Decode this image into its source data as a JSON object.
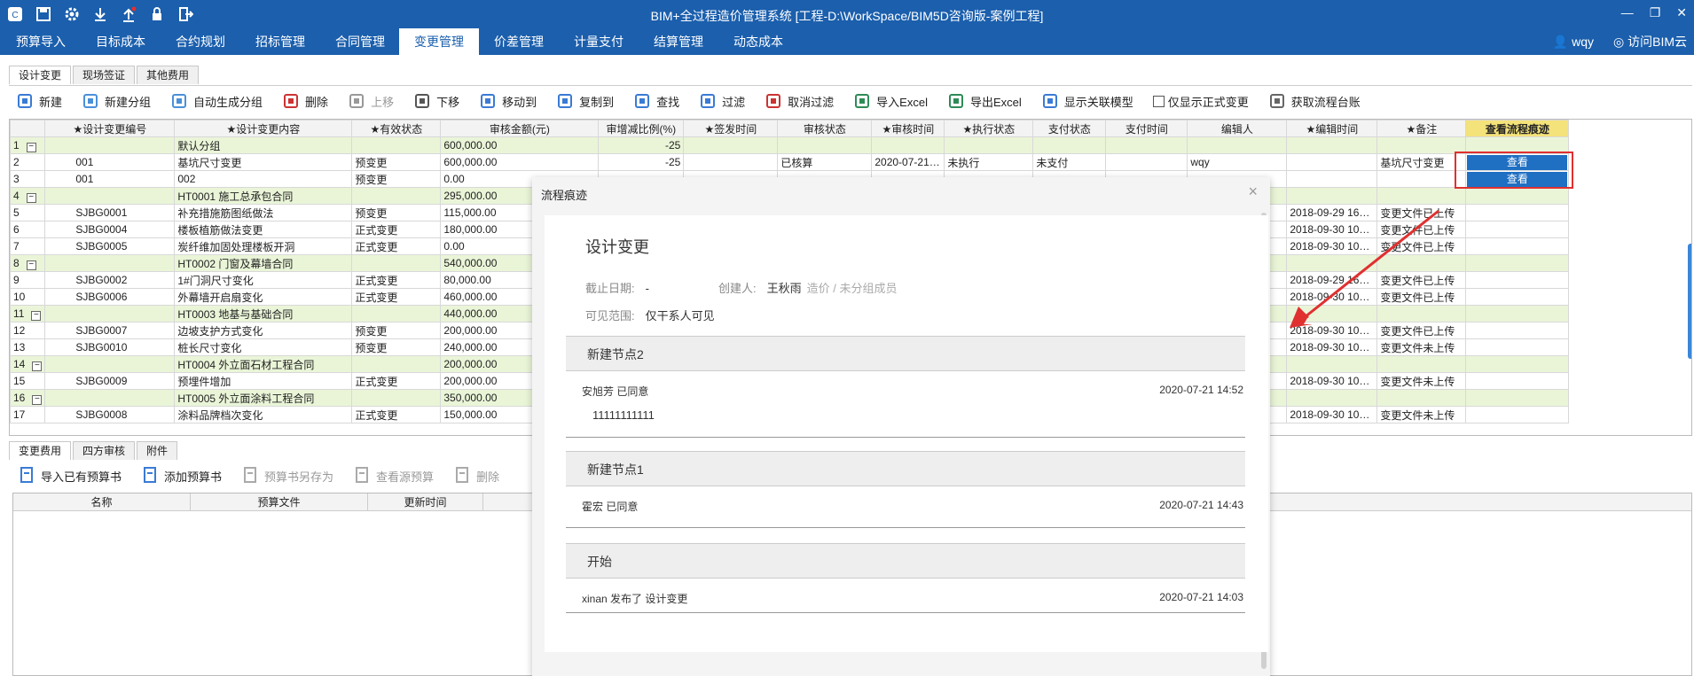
{
  "window": {
    "title": "BIM+全过程造价管理系统 [工程-D:\\WorkSpace/BIM5D咨询版-案例工程]"
  },
  "menu": [
    "预算导入",
    "目标成本",
    "合约规划",
    "招标管理",
    "合同管理",
    "变更管理",
    "价差管理",
    "计量支付",
    "结算管理",
    "动态成本"
  ],
  "user": {
    "name": "wqy",
    "visit": "访问BIM云"
  },
  "tabs": [
    "设计变更",
    "现场签证",
    "其他费用"
  ],
  "toolbar": [
    {
      "label": "新建",
      "icon": "new-file-icon",
      "disabled": false
    },
    {
      "label": "新建分组",
      "icon": "folder-icon",
      "disabled": false
    },
    {
      "label": "自动生成分组",
      "icon": "folder-icon",
      "disabled": false
    },
    {
      "label": "删除",
      "icon": "delete-icon",
      "disabled": false
    },
    {
      "label": "上移",
      "icon": "move-up-icon",
      "disabled": true
    },
    {
      "label": "下移",
      "icon": "move-down-icon",
      "disabled": false
    },
    {
      "label": "移动到",
      "icon": "move-to-icon",
      "disabled": false
    },
    {
      "label": "复制到",
      "icon": "copy-icon",
      "disabled": false
    },
    {
      "label": "查找",
      "icon": "search-icon",
      "disabled": false
    },
    {
      "label": "过滤",
      "icon": "filter-icon",
      "disabled": false
    },
    {
      "label": "取消过滤",
      "icon": "cancel-filter-icon",
      "disabled": false
    },
    {
      "label": "导入Excel",
      "icon": "excel-import-icon",
      "disabled": false
    },
    {
      "label": "导出Excel",
      "icon": "excel-export-icon",
      "disabled": false
    },
    {
      "label": "显示关联模型",
      "icon": "model-icon",
      "disabled": false
    },
    {
      "label": "仅显示正式变更",
      "icon": "checkbox",
      "disabled": false
    },
    {
      "label": "获取流程台账",
      "icon": "ledger-icon",
      "disabled": false
    }
  ],
  "grid": {
    "columns": [
      "",
      "★设计变更编号",
      "★设计变更内容",
      "★有效状态",
      "审核金额(元)",
      "审增减比例(%)",
      "★签发时间",
      "审核状态",
      "★审核时间",
      "★执行状态",
      "支付状态",
      "支付时间",
      "编辑人",
      "★编辑时间",
      "★备注",
      "查看流程痕迹"
    ],
    "view_label": "查看",
    "rows": [
      {
        "n": "1",
        "group": true,
        "code": "",
        "content": "默认分组",
        "state": "",
        "amount": "600,000.00",
        "ratio": "-25",
        "c6": "",
        "c7": "",
        "c8": "",
        "c9": "",
        "c10": "",
        "c11": "",
        "c12": "",
        "c13": "",
        "c14": "",
        "view": false
      },
      {
        "n": "2",
        "group": false,
        "code": "001",
        "content": "基坑尺寸变更",
        "state": "预变更",
        "amount": "600,000.00",
        "ratio": "-25",
        "c6": "",
        "c7": "已核算",
        "c8": "2020-07-21…",
        "c9": "未执行",
        "c10": "未支付",
        "c11": "",
        "c12": "wqy",
        "c13": "",
        "c14": "基坑尺寸变更",
        "view": true
      },
      {
        "n": "3",
        "group": false,
        "code": "001",
        "content": "002",
        "state": "预变更",
        "amount": "0.00",
        "ratio": "",
        "c6": "",
        "c7": "",
        "c8": "",
        "c9": "",
        "c10": "",
        "c11": "",
        "c12": "",
        "c13": "",
        "c14": "",
        "view": true
      },
      {
        "n": "4",
        "group": true,
        "code": "",
        "content": "HT0001 施工总承包合同",
        "state": "",
        "amount": "295,000.00",
        "ratio": "",
        "c6": "",
        "c7": "",
        "c8": "",
        "c9": "",
        "c10": "",
        "c11": "",
        "c12": "",
        "c13": "",
        "c14": "",
        "view": false
      },
      {
        "n": "5",
        "group": false,
        "code": "SJBG0001",
        "content": "补充措施筋图纸做法",
        "state": "预变更",
        "amount": "115,000.00",
        "ratio": "",
        "c6": "",
        "c7": "",
        "c8": "",
        "c9": "",
        "c10": "",
        "c11": "",
        "c12": "",
        "c13": "2018-09-29 16…",
        "c14": "变更文件已上传",
        "view": false
      },
      {
        "n": "6",
        "group": false,
        "code": "SJBG0004",
        "content": "楼板植筋做法变更",
        "state": "正式变更",
        "amount": "180,000.00",
        "ratio": "",
        "c6": "",
        "c7": "",
        "c8": "",
        "c9": "",
        "c10": "",
        "c11": "",
        "c12": "",
        "c13": "2018-09-30 10…",
        "c14": "变更文件已上传",
        "view": false
      },
      {
        "n": "7",
        "group": false,
        "code": "SJBG0005",
        "content": "炭纤维加固处理楼板开洞",
        "state": "正式变更",
        "amount": "0.00",
        "ratio": "",
        "c6": "",
        "c7": "",
        "c8": "",
        "c9": "",
        "c10": "",
        "c11": "",
        "c12": "",
        "c13": "2018-09-30 10…",
        "c14": "变更文件已上传",
        "view": false
      },
      {
        "n": "8",
        "group": true,
        "code": "",
        "content": "HT0002 门窗及幕墙合同",
        "state": "",
        "amount": "540,000.00",
        "ratio": "",
        "c6": "",
        "c7": "",
        "c8": "",
        "c9": "",
        "c10": "",
        "c11": "",
        "c12": "",
        "c13": "",
        "c14": "",
        "view": false
      },
      {
        "n": "9",
        "group": false,
        "code": "SJBG0002",
        "content": "1#门洞尺寸变化",
        "state": "正式变更",
        "amount": "80,000.00",
        "ratio": "",
        "c6": "",
        "c7": "",
        "c8": "",
        "c9": "",
        "c10": "",
        "c11": "",
        "c12": "",
        "c13": "2018-09-29 16…",
        "c14": "变更文件已上传",
        "view": false
      },
      {
        "n": "10",
        "group": false,
        "code": "SJBG0006",
        "content": "外幕墙开启扇变化",
        "state": "正式变更",
        "amount": "460,000.00",
        "ratio": "",
        "c6": "",
        "c7": "",
        "c8": "",
        "c9": "",
        "c10": "",
        "c11": "",
        "c12": "",
        "c13": "2018-09-30 10…",
        "c14": "变更文件已上传",
        "view": false
      },
      {
        "n": "11",
        "group": true,
        "code": "",
        "content": "HT0003 地基与基础合同",
        "state": "",
        "amount": "440,000.00",
        "ratio": "",
        "c6": "",
        "c7": "",
        "c8": "",
        "c9": "",
        "c10": "",
        "c11": "",
        "c12": "",
        "c13": "",
        "c14": "",
        "view": false
      },
      {
        "n": "12",
        "group": false,
        "code": "SJBG0007",
        "content": "边坡支护方式变化",
        "state": "预变更",
        "amount": "200,000.00",
        "ratio": "",
        "c6": "",
        "c7": "",
        "c8": "",
        "c9": "",
        "c10": "",
        "c11": "",
        "c12": "",
        "c13": "2018-09-30 10…",
        "c14": "变更文件已上传",
        "view": false
      },
      {
        "n": "13",
        "group": false,
        "code": "SJBG0010",
        "content": "桩长尺寸变化",
        "state": "预变更",
        "amount": "240,000.00",
        "ratio": "",
        "c6": "",
        "c7": "",
        "c8": "",
        "c9": "",
        "c10": "",
        "c11": "",
        "c12": "",
        "c13": "2018-09-30 10…",
        "c14": "变更文件未上传",
        "view": false
      },
      {
        "n": "14",
        "group": true,
        "code": "",
        "content": "HT0004 外立面石材工程合同",
        "state": "",
        "amount": "200,000.00",
        "ratio": "",
        "c6": "",
        "c7": "",
        "c8": "",
        "c9": "",
        "c10": "",
        "c11": "",
        "c12": "",
        "c13": "",
        "c14": "",
        "view": false
      },
      {
        "n": "15",
        "group": false,
        "code": "SJBG0009",
        "content": "预埋件增加",
        "state": "正式变更",
        "amount": "200,000.00",
        "ratio": "",
        "c6": "",
        "c7": "",
        "c8": "",
        "c9": "",
        "c10": "",
        "c11": "",
        "c12": "",
        "c13": "2018-09-30 10…",
        "c14": "变更文件未上传",
        "view": false
      },
      {
        "n": "16",
        "group": true,
        "code": "",
        "content": "HT0005 外立面涂料工程合同",
        "state": "",
        "amount": "350,000.00",
        "ratio": "",
        "c6": "",
        "c7": "",
        "c8": "",
        "c9": "",
        "c10": "",
        "c11": "",
        "c12": "",
        "c13": "",
        "c14": "",
        "view": false
      },
      {
        "n": "17",
        "group": false,
        "code": "SJBG0008",
        "content": "涂料品牌档次变化",
        "state": "正式变更",
        "amount": "150,000.00",
        "ratio": "",
        "c6": "",
        "c7": "",
        "c8": "",
        "c9": "",
        "c10": "",
        "c11": "",
        "c12": "",
        "c13": "2018-09-30 10…",
        "c14": "变更文件未上传",
        "view": false
      }
    ]
  },
  "bottom": {
    "tabs": [
      "变更费用",
      "四方审核",
      "附件"
    ],
    "tools": [
      {
        "label": "导入已有预算书",
        "disabled": false
      },
      {
        "label": "添加预算书",
        "disabled": false
      },
      {
        "label": "预算书另存为",
        "disabled": true
      },
      {
        "label": "查看源预算",
        "disabled": true
      },
      {
        "label": "删除",
        "disabled": true
      }
    ],
    "columns": [
      "名称",
      "预算文件",
      "更新时间"
    ]
  },
  "dialog": {
    "title": "流程痕迹",
    "close": "×",
    "heading": "设计变更",
    "deadline_label": "截止日期:",
    "deadline_value": "-",
    "creator_label": "创建人:",
    "creator_value": "王秋雨",
    "creator_sub": "造价 / 未分组成员",
    "scope_label": "可见范围:",
    "scope_value": "仅干系人可见",
    "nodes": [
      {
        "name": "新建节点2",
        "actor": "安旭芳 已同意",
        "time": "2020-07-21 14:52",
        "comment": "11111111111"
      },
      {
        "name": "新建节点1",
        "actor": "霍宏 已同意",
        "time": "2020-07-21 14:43",
        "comment": ""
      },
      {
        "name": "开始",
        "actor": "xinan 发布了 设计变更",
        "time": "2020-07-21 14:03",
        "comment": ""
      }
    ]
  },
  "colors": {
    "brand": "#1b5fad",
    "group_row": "#eaf5d8",
    "highlight_header": "#f4e27a",
    "view_button": "#1f6fc3",
    "annotation_red": "#e03030"
  }
}
